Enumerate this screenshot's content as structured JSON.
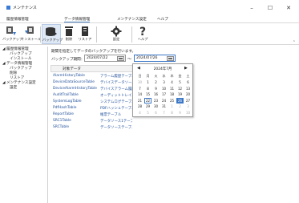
{
  "window": {
    "title": "メンテナンス",
    "minimize": "–",
    "maximize": "☐",
    "close": "✕"
  },
  "menu": [
    {
      "label": "履歴情報管理",
      "active": false
    },
    {
      "label": "データ情報管理",
      "active": true
    },
    {
      "label": "メンテナンス設定",
      "active": false
    },
    {
      "label": "ヘルプ",
      "active": false
    }
  ],
  "ribbon": [
    {
      "label": "バックアップ",
      "icon": "backup-icon"
    },
    {
      "label": "インストール",
      "icon": "install-icon"
    },
    {
      "label": "バックアップ",
      "icon": "database-backup-icon",
      "selected": true
    },
    {
      "label": "削除",
      "icon": "trash-icon"
    },
    {
      "label": "リストア",
      "icon": "restore-icon"
    },
    {
      "label": "設定",
      "icon": "gear-icon"
    },
    {
      "label": "ヘルプ",
      "icon": "help-icon"
    }
  ],
  "tree": [
    {
      "label": "◢ 履歴情報管理",
      "level": 0
    },
    {
      "label": "バックアップ",
      "level": 2
    },
    {
      "label": "インストール",
      "level": 2
    },
    {
      "label": "◢ データ情報管理",
      "level": 0
    },
    {
      "label": "バックアップ",
      "level": 2
    },
    {
      "label": "削除",
      "level": 2
    },
    {
      "label": "リストア",
      "level": 2
    },
    {
      "label": "◢ メンテナンス設定",
      "level": 0
    },
    {
      "label": "設定",
      "level": 2
    }
  ],
  "content": {
    "description": "期間を指定してデータのバックアップを行います。",
    "period_label": "バックアップ期間：",
    "date_from": "2024/07/22",
    "tilde": "～",
    "date_to": "2024/07/26"
  },
  "table": {
    "headers": [
      "対象データ",
      "説明"
    ],
    "rows": [
      {
        "name": "AlarmHistoryTable",
        "desc": "アラーム履歴テーブル"
      },
      {
        "name": "DeviceDataSourceTable",
        "desc": "デバイスデータソース"
      },
      {
        "name": "DeviceAlarmHistoryTable",
        "desc": "デバイスアラーム履歴"
      },
      {
        "name": "AuditTrailTable",
        "desc": "オーディットトレイル"
      },
      {
        "name": "SystemLogTable",
        "desc": "システムログテーブル"
      },
      {
        "name": "PdfHashTable",
        "desc": "PDFハッシュテーブル"
      },
      {
        "name": "ReportTable",
        "desc": "帳票テーブル"
      },
      {
        "name": "SRC1Table",
        "desc": "データソース1テーブル"
      },
      {
        "name": "SRCTable",
        "desc": "データソーステーブル"
      }
    ]
  },
  "calendar": {
    "prev": "◀",
    "next": "▶",
    "title": "2024年7月",
    "weekdays": [
      "日",
      "月",
      "火",
      "水",
      "木",
      "金",
      "土"
    ],
    "weeks": [
      [
        "30",
        "1",
        "2",
        "3",
        "4",
        "5",
        "6"
      ],
      [
        "7",
        "8",
        "9",
        "10",
        "11",
        "12",
        "13"
      ],
      [
        "14",
        "15",
        "16",
        "17",
        "18",
        "19",
        "20"
      ],
      [
        "21",
        "22",
        "23",
        "24",
        "25",
        "26",
        "27"
      ],
      [
        "28",
        "29",
        "30",
        "31",
        "1",
        "2",
        "3"
      ],
      [
        "4",
        "5",
        "6",
        "7",
        "8",
        "9",
        "10"
      ]
    ],
    "selected_day": "26",
    "today": "22"
  },
  "colors": {
    "accent": "#3c78c8",
    "link": "#1f4f9a"
  }
}
